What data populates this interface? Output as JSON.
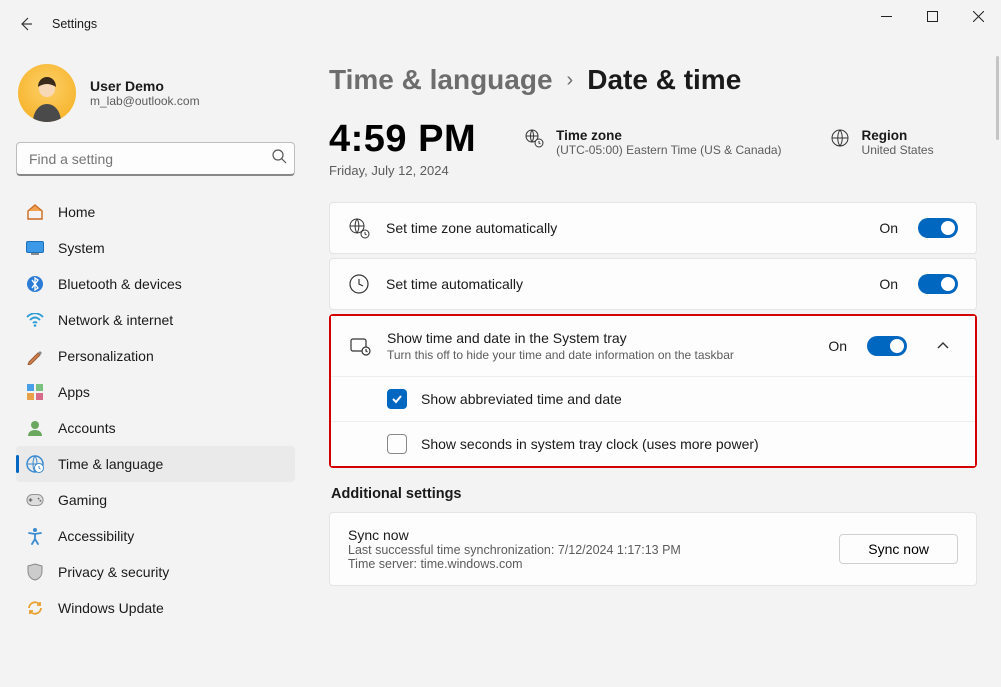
{
  "window": {
    "title": "Settings"
  },
  "user": {
    "name": "User Demo",
    "email": "m_lab@outlook.com"
  },
  "search": {
    "placeholder": "Find a setting"
  },
  "nav": [
    {
      "id": "home",
      "label": "Home"
    },
    {
      "id": "system",
      "label": "System"
    },
    {
      "id": "bluetooth",
      "label": "Bluetooth & devices"
    },
    {
      "id": "network",
      "label": "Network & internet"
    },
    {
      "id": "personalization",
      "label": "Personalization"
    },
    {
      "id": "apps",
      "label": "Apps"
    },
    {
      "id": "accounts",
      "label": "Accounts"
    },
    {
      "id": "time",
      "label": "Time & language",
      "active": true
    },
    {
      "id": "gaming",
      "label": "Gaming"
    },
    {
      "id": "accessibility",
      "label": "Accessibility"
    },
    {
      "id": "privacy",
      "label": "Privacy & security"
    },
    {
      "id": "update",
      "label": "Windows Update"
    }
  ],
  "breadcrumb": {
    "parent": "Time & language",
    "current": "Date & time"
  },
  "clock": {
    "time": "4:59 PM",
    "date": "Friday, July 12, 2024"
  },
  "timezone": {
    "label": "Time zone",
    "value": "(UTC-05:00) Eastern Time (US & Canada)"
  },
  "region": {
    "label": "Region",
    "value": "United States"
  },
  "settings": {
    "auto_tz": {
      "label": "Set time zone automatically",
      "state": "On"
    },
    "auto_time": {
      "label": "Set time automatically",
      "state": "On"
    },
    "tray": {
      "label": "Show time and date in the System tray",
      "desc": "Turn this off to hide your time and date information on the taskbar",
      "state": "On",
      "abbrev": "Show abbreviated time and date",
      "seconds": "Show seconds in system tray clock (uses more power)"
    }
  },
  "additional": {
    "title": "Additional settings",
    "sync_title": "Sync now",
    "sync_last": "Last successful time synchronization: 7/12/2024 1:17:13 PM",
    "sync_server": "Time server: time.windows.com",
    "sync_btn": "Sync now"
  }
}
